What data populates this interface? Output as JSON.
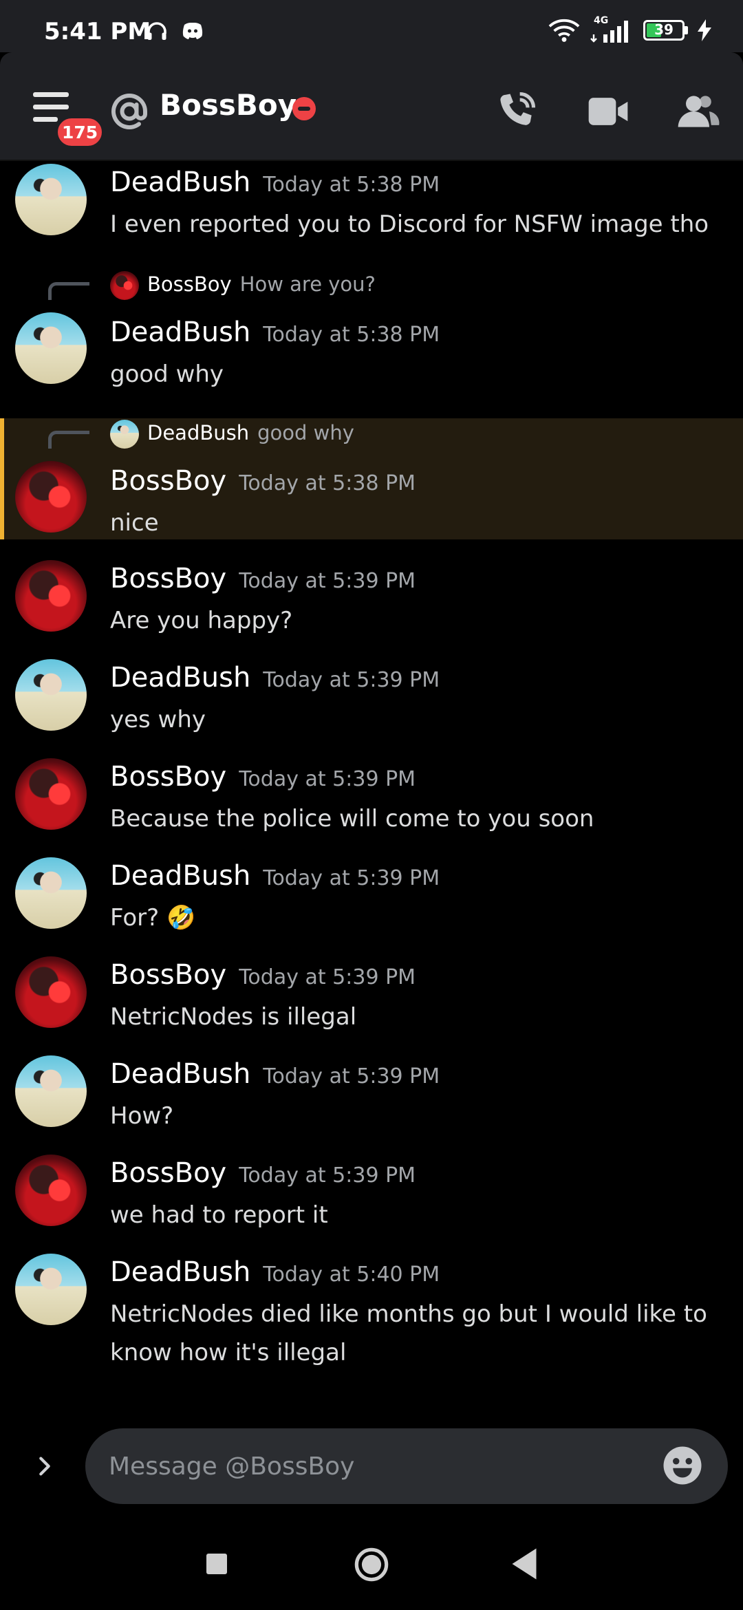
{
  "status_bar": {
    "time": "5:41 PM",
    "network": "4G",
    "battery": "39"
  },
  "header": {
    "notification_count": "175",
    "title": "BossBoy"
  },
  "messages": [
    {
      "author": "DeadBush",
      "timestamp": "Today at 5:38 PM",
      "text": "I even reported you to Discord for NSFW image tho"
    },
    {
      "reply_author": "BossBoy",
      "reply_text": "How are you?",
      "author": "DeadBush",
      "timestamp": "Today at 5:38 PM",
      "text": "good why"
    },
    {
      "reply_author": "DeadBush",
      "reply_text": "good why",
      "author": "BossBoy",
      "timestamp": "Today at 5:38 PM",
      "text": "nice"
    },
    {
      "author": "BossBoy",
      "timestamp": "Today at 5:39 PM",
      "text": "Are you happy?"
    },
    {
      "author": "DeadBush",
      "timestamp": "Today at 5:39 PM",
      "text": "yes why"
    },
    {
      "author": "BossBoy",
      "timestamp": "Today at 5:39 PM",
      "text": "Because the police will come to you soon"
    },
    {
      "author": "DeadBush",
      "timestamp": "Today at 5:39 PM",
      "text": "For? 🤣"
    },
    {
      "author": "BossBoy",
      "timestamp": "Today at 5:39 PM",
      "text": "NetricNodes is illegal"
    },
    {
      "author": "DeadBush",
      "timestamp": "Today at 5:39 PM",
      "text": "How?"
    },
    {
      "author": "BossBoy",
      "timestamp": "Today at 5:39 PM",
      "text": "we had to report it"
    },
    {
      "author": "DeadBush",
      "timestamp": "Today at 5:40 PM",
      "text": "NetricNodes died like months go but I would like to know how it's illegal"
    }
  ],
  "composer": {
    "placeholder": "Message @BossBoy"
  },
  "colors": {
    "accent_highlight": "#f0b232",
    "dnd_red": "#ed4245",
    "badge_red": "#ed4245"
  }
}
